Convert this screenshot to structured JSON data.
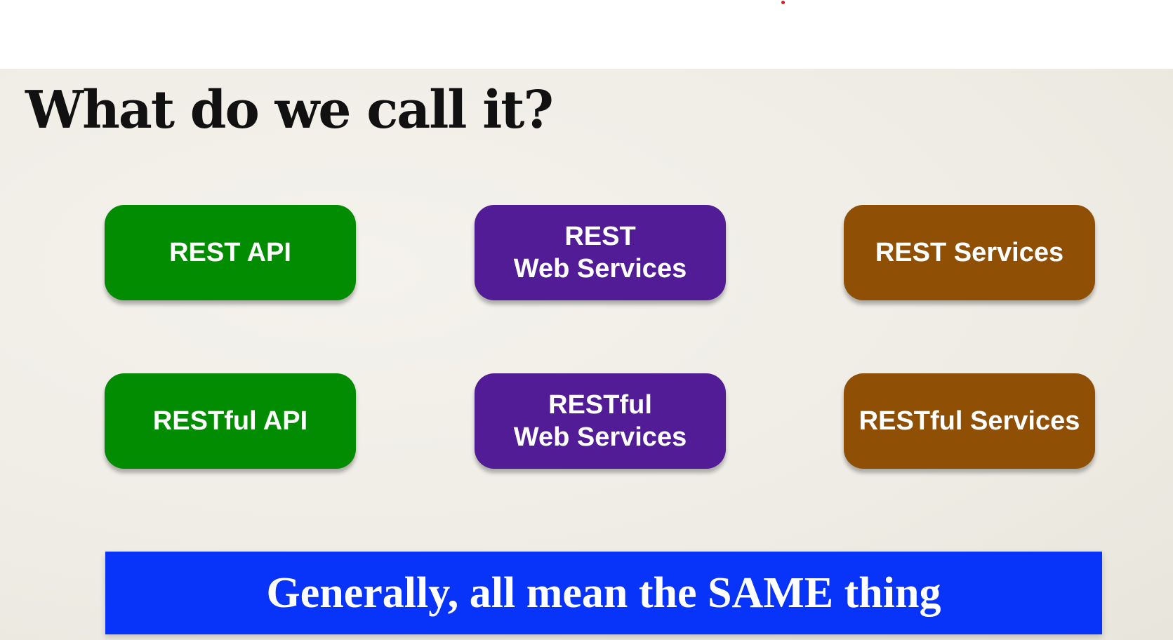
{
  "slide": {
    "title": "What do we call it?",
    "terms": [
      {
        "lines": [
          "REST API"
        ],
        "color": "#028c02"
      },
      {
        "lines": [
          "REST",
          "Web Services"
        ],
        "color": "#511c96"
      },
      {
        "lines": [
          "REST Services"
        ],
        "color": "#8f4f05"
      },
      {
        "lines": [
          "RESTful API"
        ],
        "color": "#028c02"
      },
      {
        "lines": [
          "RESTful",
          "Web Services"
        ],
        "color": "#511c96"
      },
      {
        "lines": [
          "RESTful Services"
        ],
        "color": "#8f4f05"
      }
    ],
    "banner": {
      "text": "Generally, all mean the SAME thing",
      "color": "#0833f8"
    }
  }
}
